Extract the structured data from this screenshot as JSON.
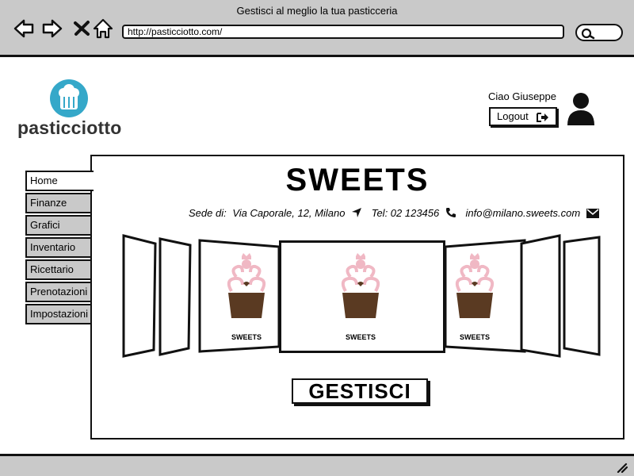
{
  "window": {
    "title": "Gestisci al meglio la tua pasticceria"
  },
  "toolbar": {
    "url": "http://pasticciotto.com/"
  },
  "brand": {
    "name": "pasticciotto"
  },
  "user": {
    "greeting": "Ciao Giuseppe",
    "logout_label": "Logout"
  },
  "sidebar": {
    "items": [
      {
        "label": "Home",
        "active": true
      },
      {
        "label": "Finanze"
      },
      {
        "label": "Grafici"
      },
      {
        "label": "Inventario"
      },
      {
        "label": "Ricettario"
      },
      {
        "label": "Prenotazioni"
      },
      {
        "label": "Impostazioni"
      }
    ]
  },
  "main": {
    "title": "SWEETS",
    "sede_label": "Sede di:",
    "address": "Via Caporale, 12, Milano",
    "phone": "Tel: 02 123456",
    "email": "info@milano.sweets.com",
    "cupcake_label": "SWEETS",
    "action_label": "GESTISCI"
  },
  "colors": {
    "logo": "#35a8c9",
    "chrome": "#c9c9c9",
    "cupcake_frosting": "#f0b8c4",
    "cupcake_base": "#5a3a22"
  }
}
